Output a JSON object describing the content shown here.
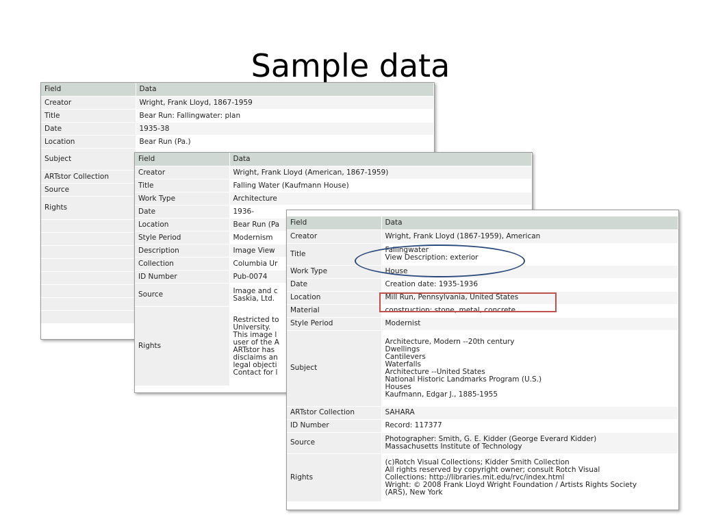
{
  "slide": {
    "title": "Sample data"
  },
  "header": {
    "field": "Field",
    "data": "Data"
  },
  "panel1": {
    "rows": [
      {
        "field": "Creator",
        "value": "Wright, Frank Lloyd, 1867-1959"
      },
      {
        "field": "Title",
        "value": "Bear Run: Fallingwater: plan"
      },
      {
        "field": "Date",
        "value": "1935-38"
      },
      {
        "field": "Location",
        "value": "Bear Run (Pa.)"
      },
      {
        "field": "Subject",
        "value": ""
      },
      {
        "field": "ARTstor Collection",
        "value": ""
      },
      {
        "field": "Source",
        "value": ""
      },
      {
        "field": "Rights",
        "value": ""
      }
    ]
  },
  "panel2": {
    "rows": [
      {
        "field": "Creator",
        "value": "Wright, Frank Lloyd (American, 1867-1959)"
      },
      {
        "field": "Title",
        "value": "Falling Water (Kaufmann House)"
      },
      {
        "field": "Work Type",
        "value": "Architecture"
      },
      {
        "field": "Date",
        "value": "1936-"
      },
      {
        "field": "Location",
        "value": "Bear Run (Pa"
      },
      {
        "field": "Style Period",
        "value": "Modernism"
      },
      {
        "field": "Description",
        "value": "Image View"
      },
      {
        "field": "Collection",
        "value": "Columbia Ur"
      },
      {
        "field": "ID Number",
        "value": "Pub-0074"
      },
      {
        "field": "Source",
        "value": "Image and c\nSaskia, Ltd."
      },
      {
        "field": "Rights",
        "value": "Restricted to\nUniversity.\nThis image l\nuser of the A\nARTstor has\ndisclaims an\nlegal objecti\nContact for l"
      }
    ]
  },
  "panel3": {
    "rows": [
      {
        "field": "Creator",
        "value": "Wright, Frank Lloyd (1867-1959), American"
      },
      {
        "field": "Title",
        "value": "Fallingwater\nView Description: exterior"
      },
      {
        "field": "Work Type",
        "value": "House"
      },
      {
        "field": "Date",
        "value": "Creation date: 1935-1936"
      },
      {
        "field": "Location",
        "value": "Mill Run, Pennsylvania, United States"
      },
      {
        "field": "Material",
        "value": "construction: stone, metal, concrete"
      },
      {
        "field": "Style Period",
        "value": "Modernist"
      },
      {
        "field": "Subject",
        "value": "Architecture, Modern --20th century\nDwellings\nCantilevers\nWaterfalls\nArchitecture --United States\nNational Historic Landmarks Program (U.S.)\nHouses\nKaufmann, Edgar J., 1885-1955"
      },
      {
        "field": "ARTstor Collection",
        "value": "SAHARA"
      },
      {
        "field": "ID Number",
        "value": "Record: 117377"
      },
      {
        "field": "Source",
        "value": "Photographer: Smith, G. E. Kidder (George Everard Kidder)\nMassachusetts Institute of Technology"
      },
      {
        "field": "Rights",
        "value": "(c)Rotch Visual Collections; Kidder Smith Collection\nAll rights reserved by copyright owner; consult Rotch Visual\nCollections: http://libraries.mit.edu/rvc/index.html\nWright: © 2008 Frank Lloyd Wright Foundation / Artists Rights Society\n(ARS), New York"
      }
    ]
  },
  "annotations": {
    "oval_color": "#2b4a7c",
    "rect_color": "#c0504d"
  }
}
